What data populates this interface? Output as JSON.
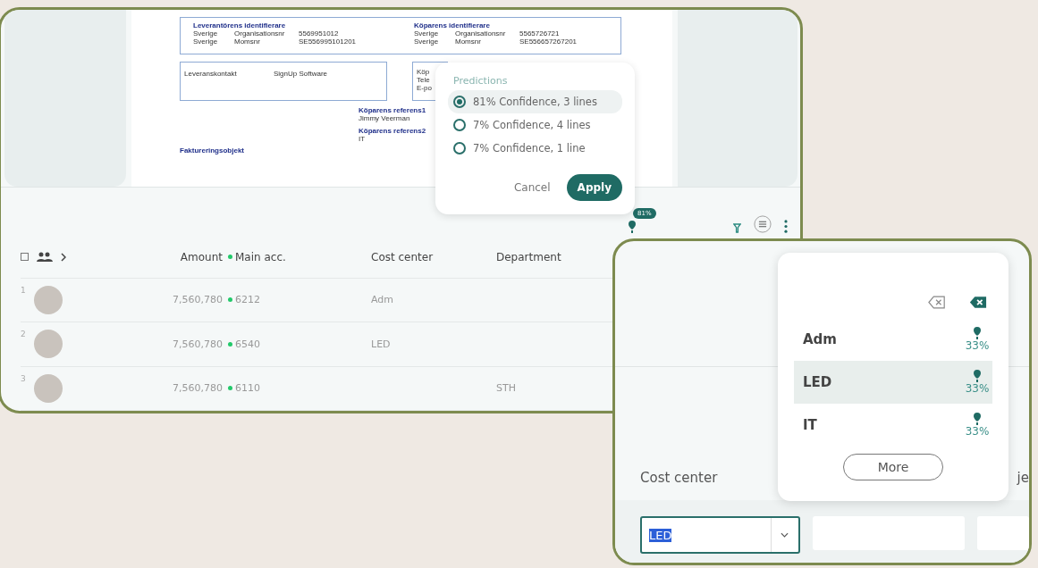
{
  "document": {
    "supplier_identifiers": {
      "heading": "Leverantörens identifierare",
      "rows": [
        [
          "Sverige",
          "Organisationsnr",
          "5569951012"
        ],
        [
          "Sverige",
          "Momsnr",
          "SE556995101201"
        ]
      ]
    },
    "buyer_identifiers": {
      "heading": "Köparens identifierare",
      "rows": [
        [
          "Sverige",
          "Organisationsnr",
          "5565726721"
        ],
        [
          "Sverige",
          "Momsnr",
          "SE556657267201"
        ]
      ]
    },
    "delivery": [
      "Leveranskontakt",
      "SignUp Software"
    ],
    "buyer_contact": [
      "Köp",
      "Tele",
      "E-po"
    ],
    "references": [
      {
        "label": "Köparens referens1",
        "value": "Jimmy Veerman"
      },
      {
        "label": "Köparens referens2",
        "value": "IT"
      }
    ],
    "section_heading": "Faktureringsobjekt"
  },
  "predictions": {
    "title": "Predictions",
    "options": [
      {
        "label": "81% Confidence, 3 lines",
        "selected": true
      },
      {
        "label": "7% Confidence, 4 lines",
        "selected": false
      },
      {
        "label": "7% Confidence, 1 line",
        "selected": false
      }
    ],
    "cancel": "Cancel",
    "apply": "Apply"
  },
  "toolbar": {
    "badge": "81%"
  },
  "table": {
    "select_all": {
      "checked": false
    },
    "columns": [
      "Amount",
      "Main acc.",
      "Cost center",
      "Department"
    ],
    "rows": [
      {
        "number": "1",
        "amount": "7,560,780",
        "account": "6212",
        "cost_center": "Adm"
      },
      {
        "number": "2",
        "amount": "7,560,780",
        "account": "6540",
        "cost_center": "LED"
      },
      {
        "number": "3",
        "amount": "7,560,780",
        "account": "6110",
        "department": "STH"
      }
    ]
  },
  "editor": {
    "label": "Cost center",
    "cut_label": "je",
    "value": "LED",
    "options": [
      {
        "label": "Adm",
        "percent": "33%",
        "selected": false
      },
      {
        "label": "LED",
        "percent": "33%",
        "selected": true
      },
      {
        "label": "IT",
        "percent": "33%",
        "selected": false
      }
    ],
    "more": "More"
  }
}
